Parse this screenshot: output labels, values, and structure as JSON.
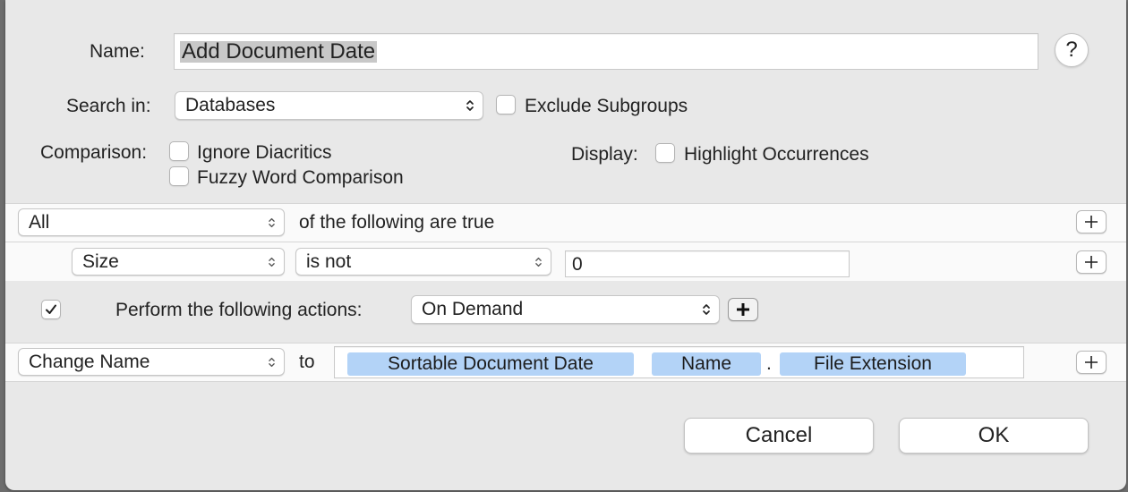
{
  "name_label": "Name:",
  "name_value": "Add Document Date",
  "help_label": "?",
  "search_in_label": "Search in:",
  "search_in_value": "Databases",
  "exclude_subgroups_label": "Exclude Subgroups",
  "exclude_subgroups_checked": false,
  "comparison_label": "Comparison:",
  "ignore_diacritics_label": "Ignore Diacritics",
  "fuzzy_word_label": "Fuzzy Word Comparison",
  "display_label": "Display:",
  "highlight_occurrences_label": "Highlight Occurrences",
  "conditions": {
    "match_value": "All",
    "match_suffix": "of the following are true",
    "rule": {
      "field": "Size",
      "operator": "is not",
      "value": "0"
    }
  },
  "actions": {
    "enabled": true,
    "label": "Perform the following actions:",
    "trigger": "On Demand",
    "action": {
      "type": "Change Name",
      "to_label": "to",
      "tokens": [
        "Sortable Document Date",
        "Name",
        "File Extension"
      ],
      "separator": "."
    }
  },
  "buttons": {
    "cancel": "Cancel",
    "ok": "OK"
  }
}
